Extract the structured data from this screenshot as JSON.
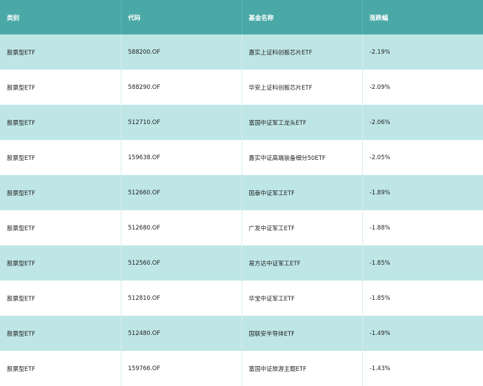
{
  "table": {
    "headers": [
      "类别",
      "代码",
      "基金名称",
      "涨跌幅"
    ],
    "rows": [
      [
        "股票型ETF",
        "588200.OF",
        "嘉实上证科创板芯片ETF",
        "-2.19%"
      ],
      [
        "股票型ETF",
        "588290.OF",
        "华安上证科创板芯片ETF",
        "-2.09%"
      ],
      [
        "股票型ETF",
        "512710.OF",
        "富国中证军工龙头ETF",
        "-2.06%"
      ],
      [
        "股票型ETF",
        "159638.OF",
        "嘉实中证高端装备细分50ETF",
        "-2.05%"
      ],
      [
        "股票型ETF",
        "512660.OF",
        "国泰中证军工ETF",
        "-1.89%"
      ],
      [
        "股票型ETF",
        "512680.OF",
        "广发中证军工ETF",
        "-1.88%"
      ],
      [
        "股票型ETF",
        "512560.OF",
        "易方达中证军工ETF",
        "-1.85%"
      ],
      [
        "股票型ETF",
        "512810.OF",
        "华宝中证军工ETF",
        "-1.85%"
      ],
      [
        "股票型ETF",
        "512480.OF",
        "国联安半导体ETF",
        "-1.49%"
      ],
      [
        "股票型ETF",
        "159766.OF",
        "富国中证旅游主题ETF",
        "-1.43%"
      ]
    ]
  }
}
